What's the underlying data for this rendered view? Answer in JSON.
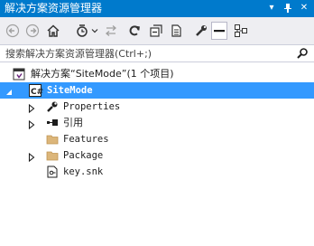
{
  "window": {
    "title": "解决方案资源管理器",
    "pin_glyph": "▾",
    "pushpin_glyph": "ᵽ",
    "close_glyph": "✕"
  },
  "toolbar": {
    "buttons": [
      {
        "name": "back-icon"
      },
      {
        "name": "forward-icon"
      },
      {
        "name": "home-icon"
      },
      {
        "name": "pending-changes-filter-icon"
      },
      {
        "name": "sync-with-active-document-icon"
      },
      {
        "name": "refresh-icon"
      },
      {
        "name": "collapse-all-icon"
      },
      {
        "name": "show-all-files-icon"
      },
      {
        "name": "properties-icon"
      },
      {
        "name": "preview-selected-items-icon"
      },
      {
        "name": "class-view-icon"
      }
    ]
  },
  "search": {
    "placeholder": "搜索解决方案资源管理器(Ctrl+;)"
  },
  "tree": {
    "solution": "解决方案“SiteMode”(1 个项目)",
    "project": "SiteMode",
    "items": [
      {
        "label": "Properties",
        "icon": "wrench-icon",
        "expandable": true
      },
      {
        "label": "引用",
        "icon": "references-icon",
        "expandable": true
      },
      {
        "label": "Features",
        "icon": "folder-icon",
        "expandable": false
      },
      {
        "label": "Package",
        "icon": "package-folder-icon",
        "expandable": true
      },
      {
        "label": "key.snk",
        "icon": "key-file-icon",
        "expandable": false
      }
    ]
  },
  "colors": {
    "accent": "#007acc",
    "selection": "#3399ff",
    "toolbar_bg": "#eeeef2"
  }
}
